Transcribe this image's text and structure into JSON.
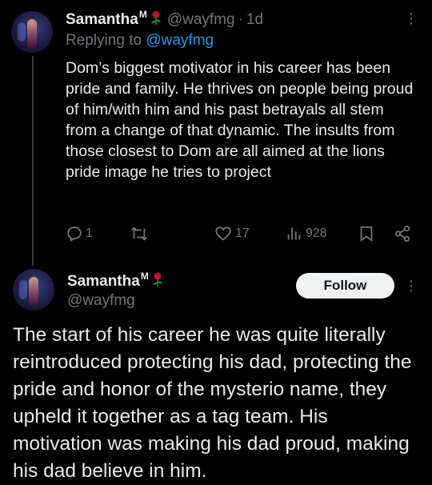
{
  "tweet1": {
    "author_name": "Samantha",
    "author_sup": "M",
    "handle": "@wayfmg",
    "separator": "·",
    "time": "1d",
    "replying_prefix": "Replying to",
    "replying_to": "@wayfmg",
    "text": "Dom’s biggest motivator in his career has been pride and family. He thrives on people being proud of him/with him and his past betrayals all stem from a change of that dynamic. The insults from those closest to Dom are all aimed at the lions pride image he tries to project",
    "replies": "1",
    "reposts": "",
    "likes": "17",
    "views": "928"
  },
  "tweet2": {
    "author_name": "Samantha",
    "author_sup": "M",
    "handle": "@wayfmg",
    "follow_label": "Follow",
    "text": "The start of his career he was quite literally reintroduced protecting his dad, protecting the pride and honor of the mysterio name, they upheld it together as a tag team. His motivation was making his dad proud, making his dad believe in him."
  },
  "icons": {
    "reply": "reply-icon",
    "repost": "repost-icon",
    "like": "heart-icon",
    "views": "views-icon",
    "bookmark": "bookmark-icon",
    "share": "share-icon",
    "more": "more-icon",
    "rose": "rose-emoji-icon"
  },
  "colors": {
    "background": "#000000",
    "text": "#e7e9ea",
    "muted": "#71767b",
    "link": "#1d9bf0",
    "follow_bg": "#eff3f4",
    "follow_text": "#0f1419"
  }
}
